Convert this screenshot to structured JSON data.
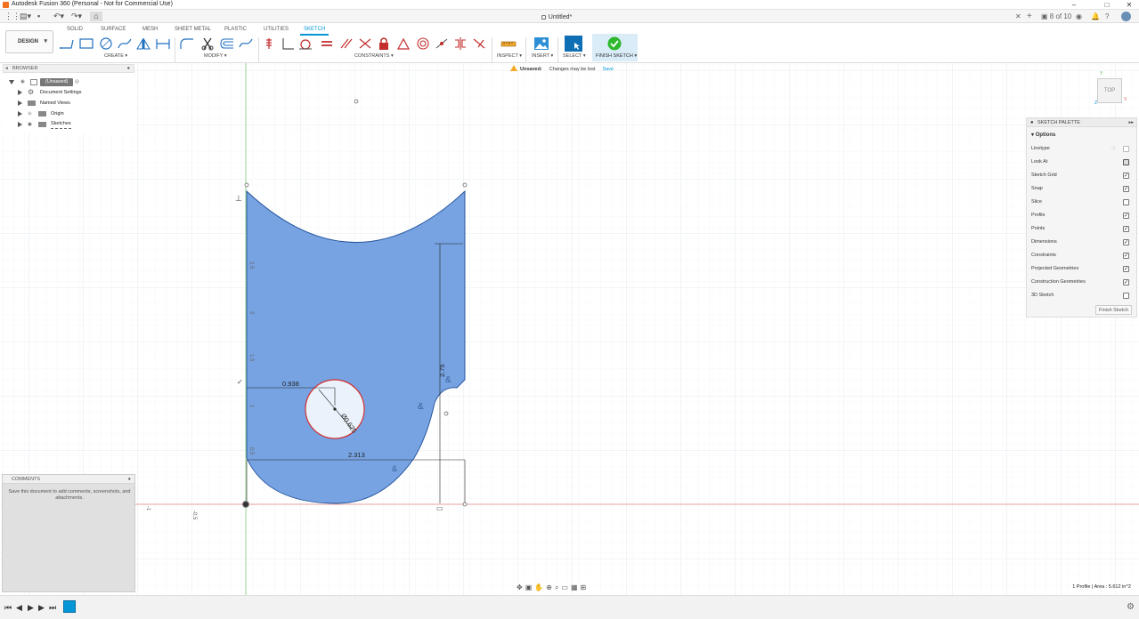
{
  "window": {
    "title": "Autodesk Fusion 360 (Personal - Not for Commercial Use)",
    "document_tab": "Untitled*",
    "job_status": "8 of 10"
  },
  "workspace": {
    "mode": "DESIGN",
    "tabs": [
      "SOLID",
      "SURFACE",
      "MESH",
      "SHEET METAL",
      "PLASTIC",
      "UTILITIES",
      "SKETCH"
    ],
    "active_tab": "SKETCH"
  },
  "toolbar": {
    "create_label": "CREATE",
    "modify_label": "MODIFY",
    "constraints_label": "CONSTRAINTS",
    "inspect_label": "INSPECT",
    "insert_label": "INSERT",
    "select_label": "SELECT",
    "finish_sketch_label": "FINISH SKETCH"
  },
  "unsaved_bar": {
    "title": "Unsaved:",
    "message": "Changes may be lost",
    "save_label": "Save"
  },
  "browser": {
    "header": "BROWSER",
    "root": "(Unsaved)",
    "items": [
      "Document Settings",
      "Named Views",
      "Origin",
      "Sketches"
    ]
  },
  "comments": {
    "header": "COMMENTS",
    "message": "Save this document to add comments, screenshots, and attachments."
  },
  "sketch_palette": {
    "header": "SKETCH PALETTE",
    "options_header": "Options",
    "options": [
      {
        "label": "Linetype",
        "type": "linetype"
      },
      {
        "label": "Look At",
        "type": "icon"
      },
      {
        "label": "Sketch Grid",
        "type": "checkbox",
        "checked": true
      },
      {
        "label": "Snap",
        "type": "checkbox",
        "checked": true
      },
      {
        "label": "Slice",
        "type": "checkbox",
        "checked": false
      },
      {
        "label": "Profile",
        "type": "checkbox",
        "checked": true
      },
      {
        "label": "Points",
        "type": "checkbox",
        "checked": true
      },
      {
        "label": "Dimensions",
        "type": "checkbox",
        "checked": true
      },
      {
        "label": "Constraints",
        "type": "checkbox",
        "checked": true
      },
      {
        "label": "Projected Geometries",
        "type": "checkbox",
        "checked": true
      },
      {
        "label": "Construction Geometries",
        "type": "checkbox",
        "checked": true
      },
      {
        "label": "3D Sketch",
        "type": "checkbox",
        "checked": false
      }
    ],
    "finish_button": "Finish Sketch"
  },
  "viewcube": {
    "face": "TOP",
    "axis_x": "X",
    "axis_y": "Y",
    "axis_z": "Z"
  },
  "sketch": {
    "dim_width": "0.938",
    "dim_diameter": "Ø0.625",
    "dim_height": "2.75",
    "dim_base": "2.313",
    "axis_ticks": [
      "2.5",
      "2",
      "1.5",
      "1",
      "0.5"
    ],
    "axis_neg": [
      "-1",
      "-0.5"
    ]
  },
  "status": {
    "profile": "1 Profile | Area : 5.612 in^2"
  },
  "colors": {
    "accent": "#0696d7",
    "profile_fill": "#6b9bdf",
    "profile_stroke": "#1f4f99",
    "grid": "#e9eef3",
    "x_axis": "#e06464",
    "y_axis": "#5dbd5d",
    "finish_green": "#2eb82e"
  }
}
